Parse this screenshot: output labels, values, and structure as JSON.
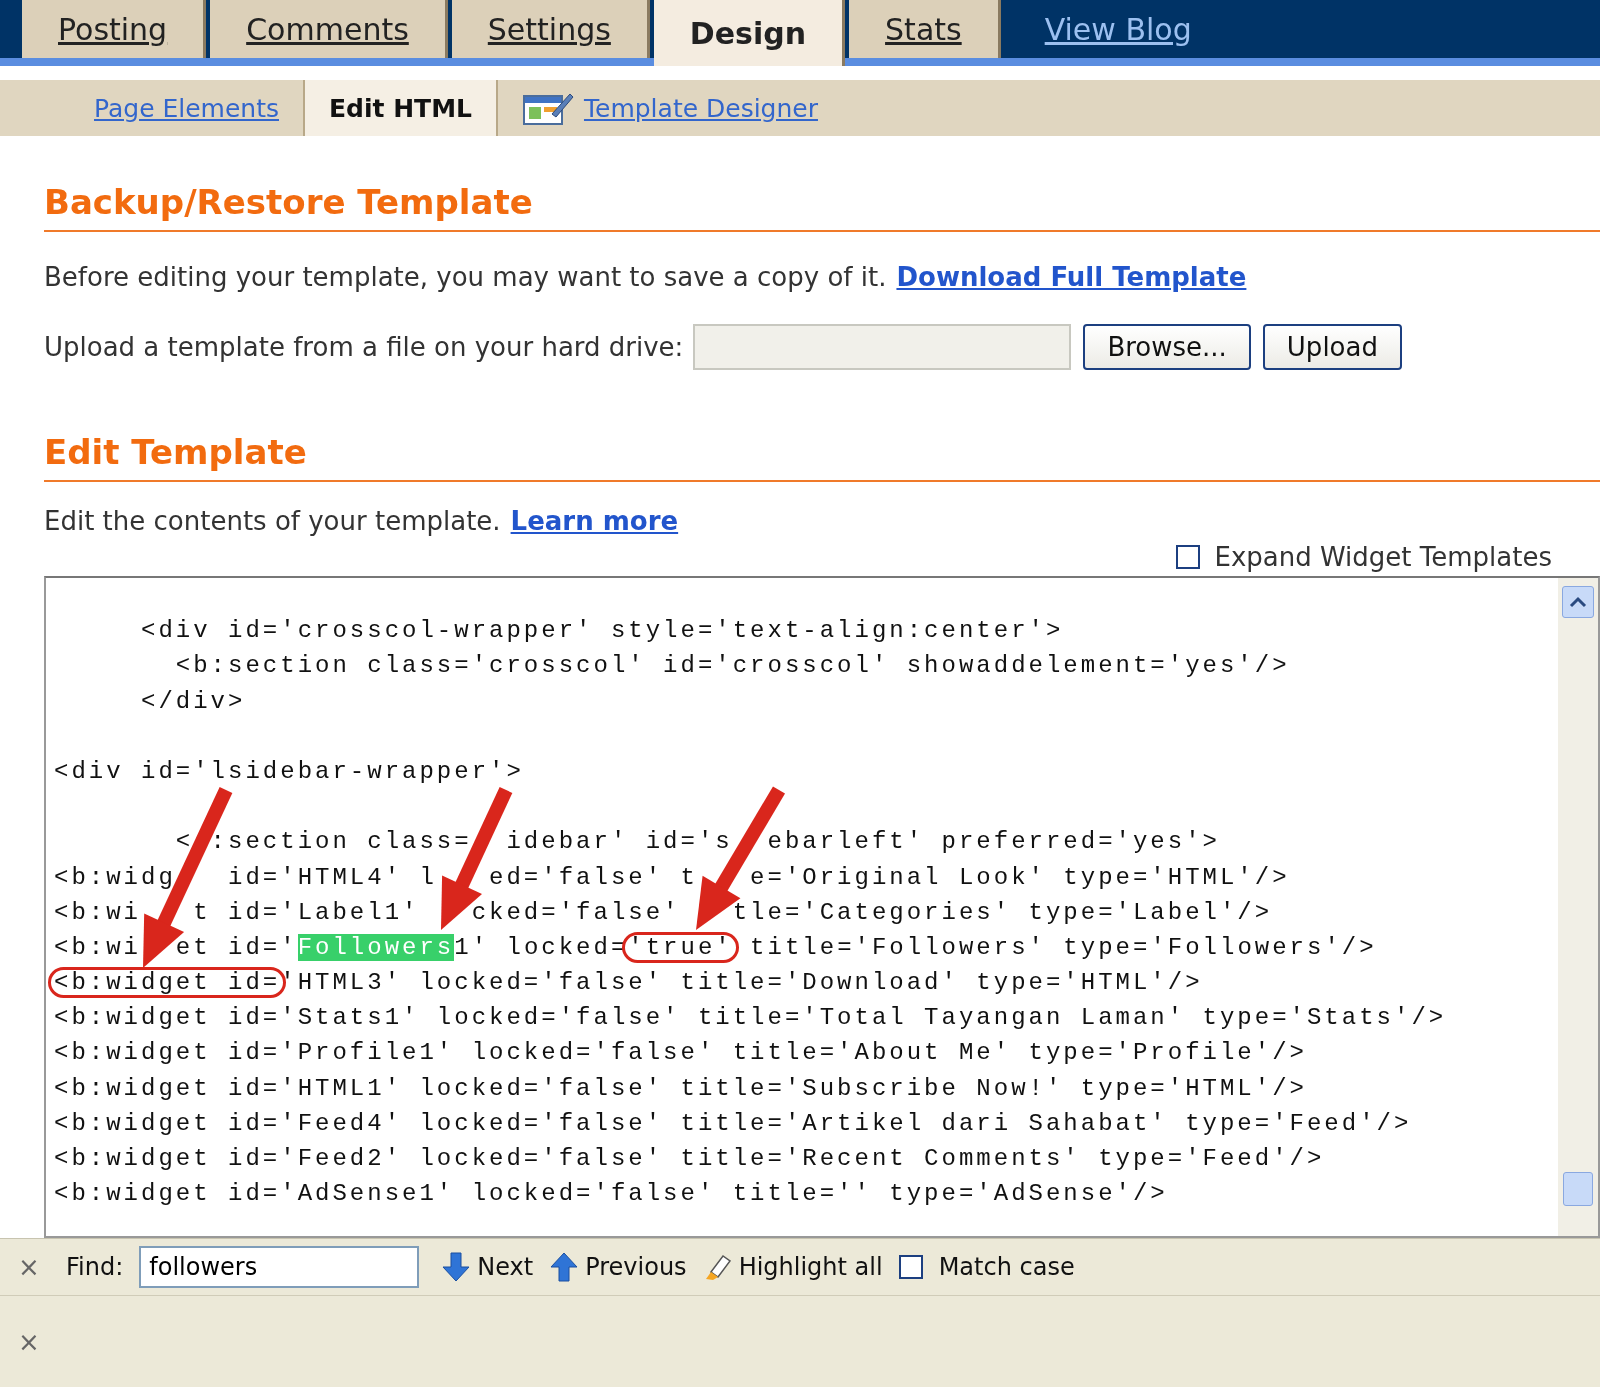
{
  "tabs": [
    {
      "label": "Posting",
      "selected": false
    },
    {
      "label": "Comments",
      "selected": false
    },
    {
      "label": "Settings",
      "selected": false
    },
    {
      "label": "Design",
      "selected": true
    },
    {
      "label": "Stats",
      "selected": false
    }
  ],
  "view_link": "View Blog",
  "subtabs": [
    {
      "label": "Page Elements",
      "selected": false,
      "kind": "link"
    },
    {
      "label": "Edit HTML",
      "selected": true,
      "kind": "link"
    },
    {
      "label": "Template Designer",
      "selected": false,
      "kind": "icon-link"
    }
  ],
  "backup": {
    "heading": "Backup/Restore Template",
    "text": "Before editing your template, you may want to save a copy of it.",
    "link": "Download Full Template",
    "upload_label": "Upload a template from a file on your hard drive:",
    "browse": "Browse...",
    "upload": "Upload"
  },
  "edit": {
    "heading": "Edit Template",
    "text": "Edit the contents of your template.",
    "link": "Learn more",
    "expand": {
      "label": "Expand Widget Templates",
      "checked": false
    },
    "code_lines": [
      {
        "kind": "blank"
      },
      {
        "kind": "code",
        "segments": [
          {
            "text": "     <div id='crosscol-wrapper' style='text-align:center'>",
            "kind": "plain"
          }
        ]
      },
      {
        "kind": "code",
        "segments": [
          {
            "text": "       <b:section class='crosscol' id='crosscol' showaddelement='yes'/>",
            "kind": "plain"
          }
        ]
      },
      {
        "kind": "code",
        "segments": [
          {
            "text": "     </div>",
            "kind": "plain"
          }
        ]
      },
      {
        "kind": "blank"
      },
      {
        "kind": "code",
        "segments": [
          {
            "text": "<div id='lsidebar-wrapper'>",
            "kind": "plain"
          }
        ]
      },
      {
        "kind": "blank"
      },
      {
        "kind": "code",
        "segments": [
          {
            "text": "       < :section class=  idebar' id='s  ebarleft' preferred='yes'>",
            "kind": "plain"
          }
        ]
      },
      {
        "kind": "code",
        "segments": [
          {
            "text": "<b:widg   id='HTML4' l   ed='false' t   e='Original Look' type='HTML'/>",
            "kind": "plain"
          }
        ]
      },
      {
        "kind": "code",
        "segments": [
          {
            "text": "<b:wi   t id='Label1'   cked='false'   tle='Categories' type='Label'/>",
            "kind": "plain"
          }
        ]
      },
      {
        "kind": "code",
        "segments": [
          {
            "text": "<b:wi  et id='",
            "kind": "plain"
          },
          {
            "text": "Followers",
            "kind": "match"
          },
          {
            "text": "1' locked=",
            "kind": "plain"
          },
          {
            "text": "'true'",
            "kind": "circled"
          },
          {
            "text": " title='Followers' type='Followers'/>",
            "kind": "plain"
          }
        ]
      },
      {
        "kind": "code",
        "segments": [
          {
            "text": "<b:widget id=",
            "kind": "circled"
          },
          {
            "text": "'HTML3' locked='false' title='Download' type='HTML'/>",
            "kind": "plain"
          }
        ]
      },
      {
        "kind": "code",
        "segments": [
          {
            "text": "<b:widget id='Stats1' locked='false' title='Total Tayangan Laman' type='Stats'/>",
            "kind": "plain"
          }
        ]
      },
      {
        "kind": "code",
        "segments": [
          {
            "text": "<b:widget id='Profile1' locked='false' title='About Me' type='Profile'/>",
            "kind": "plain"
          }
        ]
      },
      {
        "kind": "code",
        "segments": [
          {
            "text": "<b:widget id='HTML1' locked='false' title='Subscribe Now!' type='HTML'/>",
            "kind": "plain"
          }
        ]
      },
      {
        "kind": "code",
        "segments": [
          {
            "text": "<b:widget id='Feed4' locked='false' title='Artikel dari Sahabat' type='Feed'/>",
            "kind": "plain"
          }
        ]
      },
      {
        "kind": "code",
        "segments": [
          {
            "text": "<b:widget id='Feed2' locked='false' title='Recent Comments' type='Feed'/>",
            "kind": "plain"
          }
        ]
      },
      {
        "kind": "code",
        "segments": [
          {
            "text": "<b:widget id='AdSense1' locked='false' title='' type='AdSense'/>",
            "kind": "plain"
          }
        ]
      }
    ]
  },
  "find_bar": {
    "close": "×",
    "label": "Find:",
    "value": "followers",
    "next": "Next",
    "previous": "Previous",
    "highlight_all": "Highlight all",
    "match_case": {
      "label": "Match case",
      "checked": false
    },
    "close_second": "×"
  }
}
